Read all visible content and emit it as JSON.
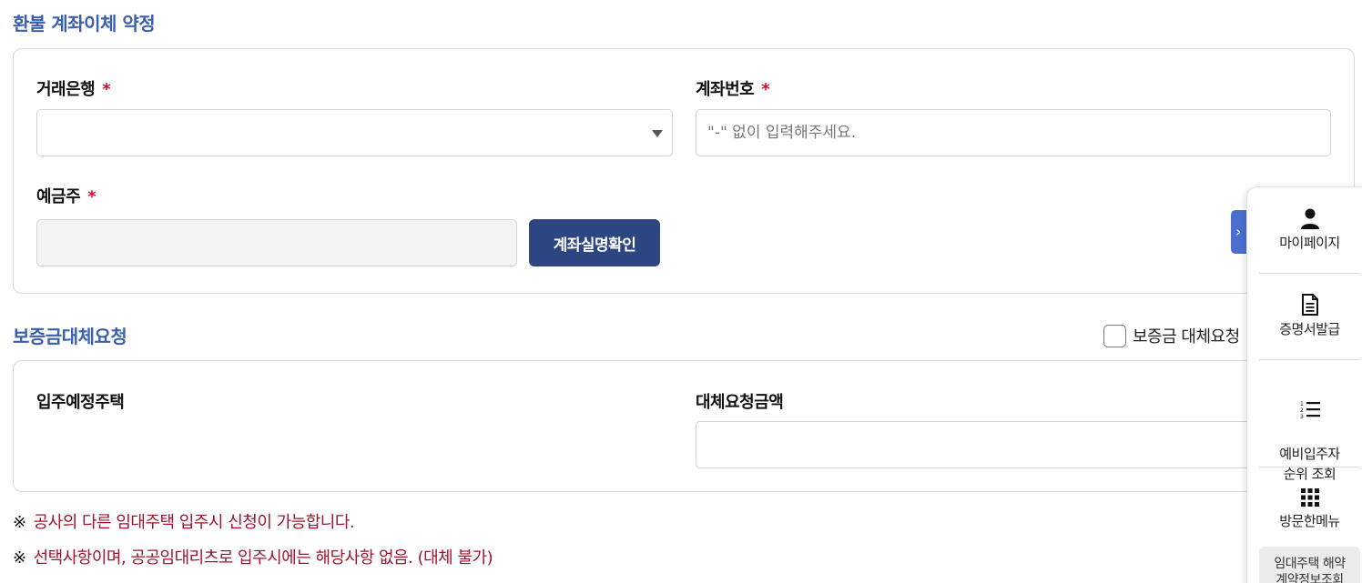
{
  "sections": {
    "refund_title": "환불 계좌이체 약정",
    "deposit_title": "보증금대체요청"
  },
  "refund_form": {
    "bank_label": "거래은행",
    "bank_value": "",
    "account_label": "계좌번호",
    "account_value": "",
    "account_placeholder": "\"-\" 없이 입력해주세요.",
    "holder_label": "예금주",
    "holder_value": "",
    "verify_button": "계좌실명확인",
    "required_mark": "*"
  },
  "deposit_form": {
    "checkbox_label": "보증금 대체요청",
    "checkbox_checked": false,
    "house_label": "입주예정주택",
    "amount_label": "대체요청금액",
    "amount_value": ""
  },
  "notes": {
    "mark": "※",
    "note1": "공사의 다른 임대주택 입주시 신청이 가능합니다.",
    "note2": "선택사항이며, 공공임대리츠로 입주시에는 해당사항 없음. (대체 불가)"
  },
  "quick_menu": {
    "items": [
      {
        "label": "마이페이지",
        "icon": "person-icon"
      },
      {
        "label": "증명서발급",
        "icon": "document-icon"
      },
      {
        "label": "예비입주자\n순위 조회",
        "icon": "numbered-list-icon"
      },
      {
        "label": "방문한메뉴",
        "icon": "grid-icon"
      }
    ],
    "bottom_label": "임대주택 해약\n계약정보조회",
    "toggle_icon": "chevron-right-icon"
  },
  "colors": {
    "title": "#3a5fb0",
    "primary_button": "#2d4580",
    "required": "#c8102e",
    "note": "#a0122d"
  }
}
